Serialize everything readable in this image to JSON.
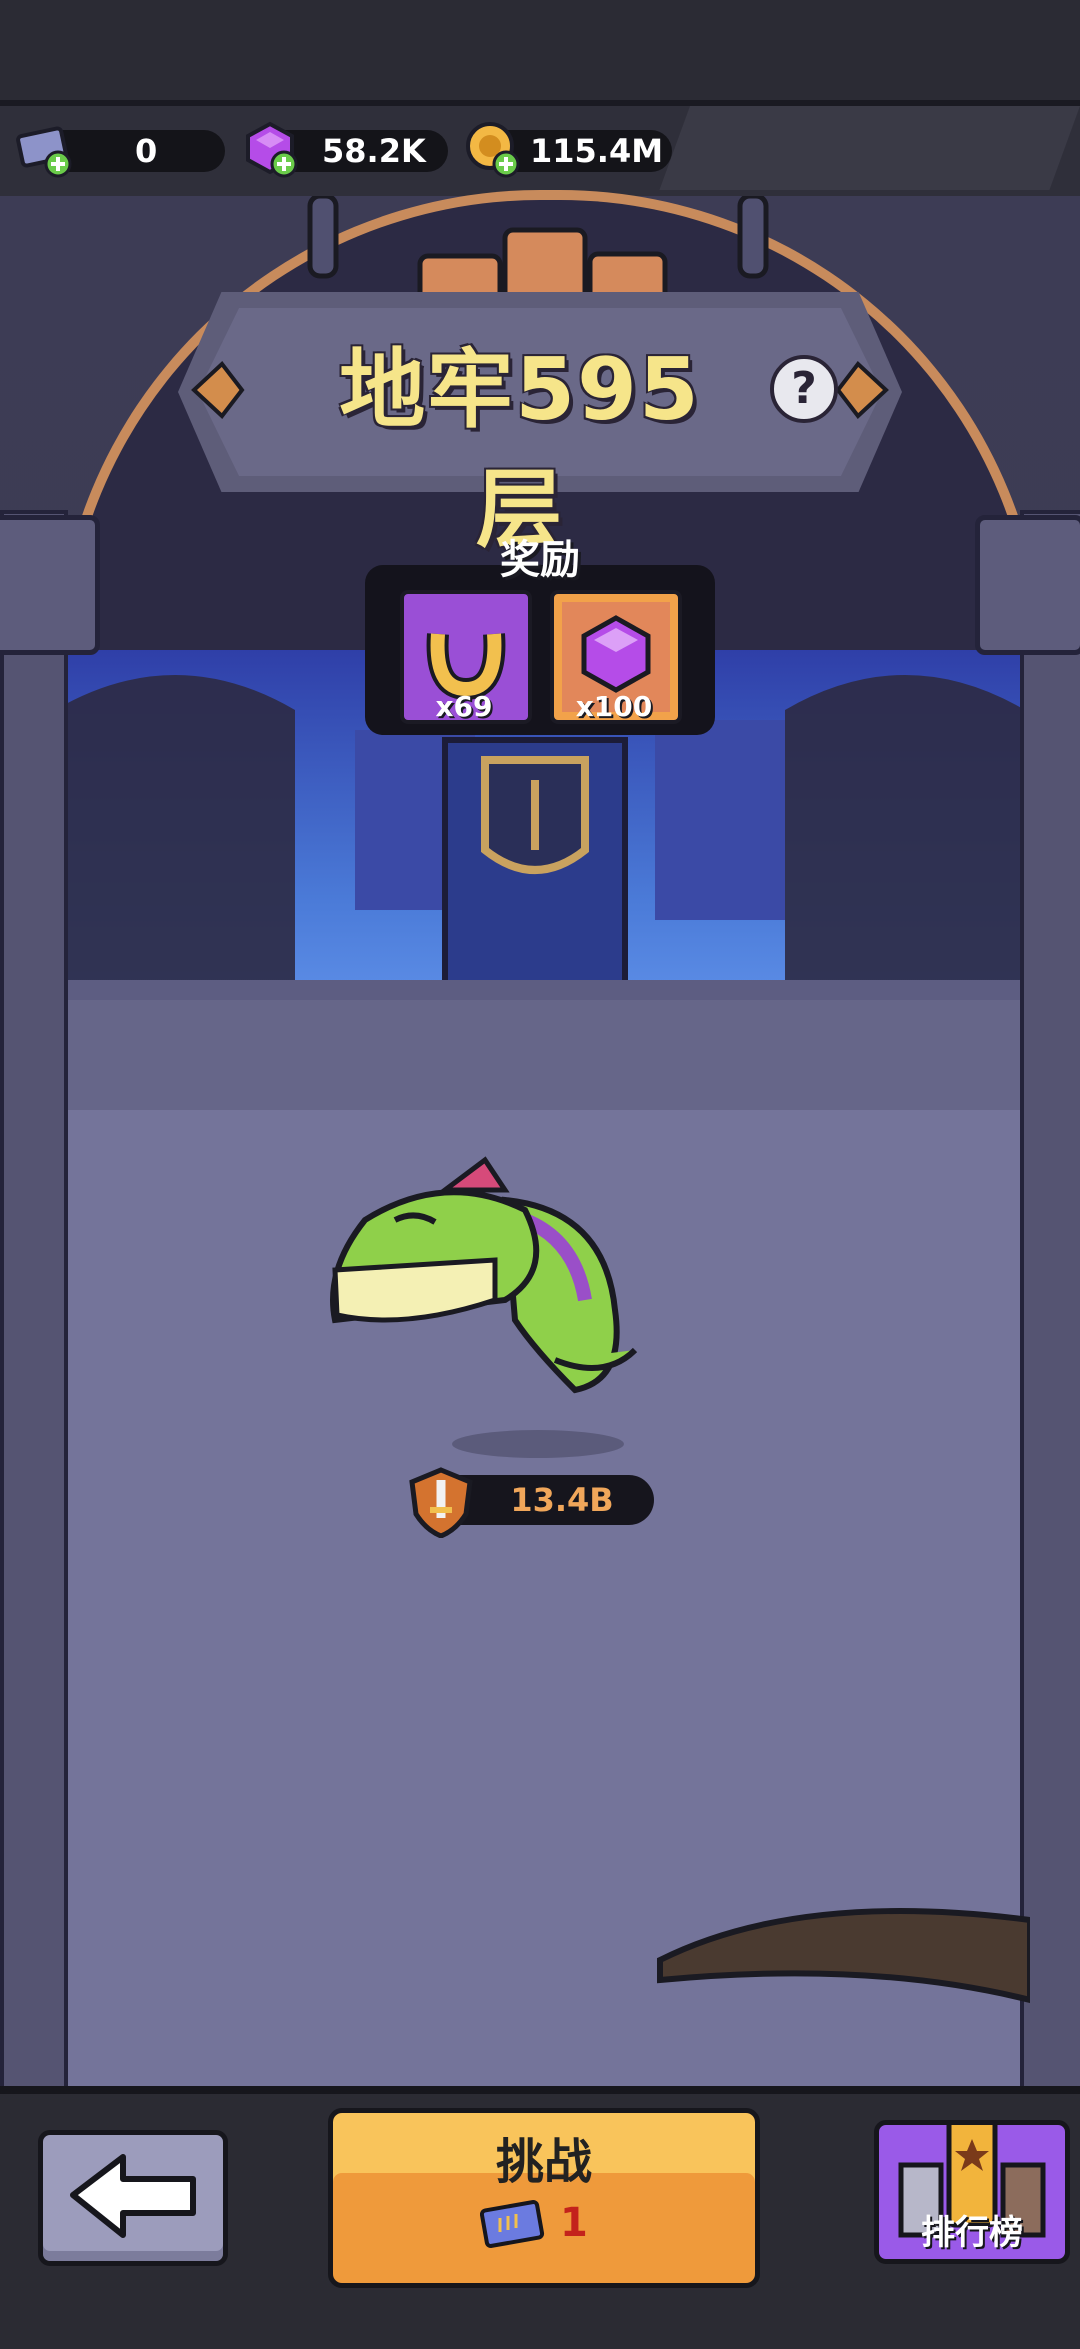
{
  "resources": {
    "tickets": "0",
    "gems": "58.2K",
    "coins": "115.4M"
  },
  "dungeon": {
    "title": "地牢595层"
  },
  "rewards": {
    "label": "奖励",
    "items": [
      {
        "icon": "horseshoe-icon",
        "qty": "x69"
      },
      {
        "icon": "purple-gem-icon",
        "qty": "x100"
      }
    ]
  },
  "enemy": {
    "power": "13.4B"
  },
  "bottom": {
    "challenge_label": "挑战",
    "challenge_cost": "1",
    "rank_label": "排行榜"
  },
  "colors": {
    "title": "#f6e58a",
    "challenge": "#ef9a3b",
    "rank": "#9a5ae8"
  }
}
